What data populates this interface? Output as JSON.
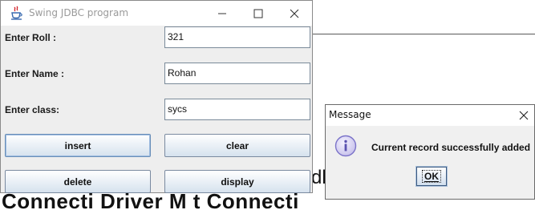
{
  "background": {
    "fragment_right": "db",
    "fragment_bottom": "Connecti          Driver M          t Connecti"
  },
  "window": {
    "title": "Swing JDBC program",
    "icons": {
      "app": "java-cup-icon",
      "minimize": "minimize-icon",
      "maximize": "maximize-icon",
      "close": "close-icon"
    }
  },
  "form": {
    "roll": {
      "label": "Enter Roll :",
      "value": "321"
    },
    "name": {
      "label": "Enter Name :",
      "value": "Rohan"
    },
    "class": {
      "label": "Enter class:",
      "value": "sycs"
    }
  },
  "buttons": {
    "insert": "insert",
    "clear": "clear",
    "delete": "delete",
    "display": "display"
  },
  "dialog": {
    "title": "Message",
    "message": "Current record successfully added",
    "ok_label": "OK",
    "icon": "info-icon"
  },
  "colors": {
    "window_bg": "#eeeeee",
    "button_gradient_bottom": "#d6e2ee",
    "info_icon": "#7b73c9"
  }
}
